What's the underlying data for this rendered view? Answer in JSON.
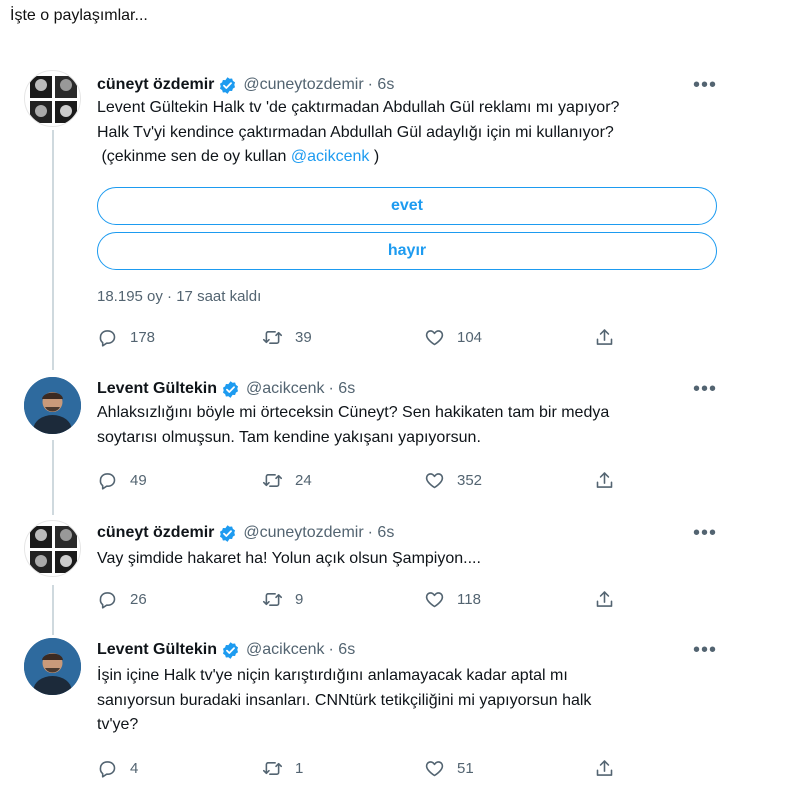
{
  "caption": "İşte o paylaşımlar...",
  "colors": {
    "accent": "#1d9bf0",
    "muted": "#536471",
    "text": "#0f1419",
    "thread_line": "#cfd9de"
  },
  "icons": {
    "reply": "reply-icon",
    "retweet": "retweet-icon",
    "like": "heart-icon",
    "share": "share-icon",
    "verified": "verified-badge-icon",
    "more": "more-icon"
  },
  "tweets": [
    {
      "name": "cüneyt özdemir",
      "handle": "@cuneytozdemir",
      "time": "· 6s",
      "more": "•••",
      "text_lines": [
        "Levent Gültekin Halk tv 'de çaktırmadan Abdullah Gül reklamı mı yapıyor?",
        "Halk Tv'yi kendince çaktırmadan Abdullah Gül adaylığı için mi kullanıyor?",
        " (çekinme sen de oy kullan "
      ],
      "mention": "@acikcenk",
      "mention_suffix": " )",
      "poll": {
        "options": [
          "evet",
          "hayır"
        ],
        "info": "18.195 oy · 17 saat kaldı"
      },
      "stats": {
        "replies": "178",
        "retweets": "39",
        "likes": "104"
      }
    },
    {
      "name": "Levent Gültekin",
      "handle": "@acikcenk",
      "time": "· 6s",
      "more": "•••",
      "text_lines": [
        "Ahlaksızlığını böyle mi örteceksin Cüneyt? Sen hakikaten tam bir medya",
        "soytarısı olmuşsun. Tam kendine yakışanı yapıyorsun."
      ],
      "stats": {
        "replies": "49",
        "retweets": "24",
        "likes": "352"
      }
    },
    {
      "name": "cüneyt özdemir",
      "handle": "@cuneytozdemir",
      "time": "· 6s",
      "more": "•••",
      "text_lines": [
        "Vay şimdide hakaret ha! Yolun açık olsun Şampiyon...."
      ],
      "stats": {
        "replies": "26",
        "retweets": "9",
        "likes": "118"
      }
    },
    {
      "name": "Levent Gültekin",
      "handle": "@acikcenk",
      "time": "· 6s",
      "more": "•••",
      "text_lines": [
        "İşin içine Halk tv'ye niçin karıştırdığını anlamayacak kadar aptal mı",
        "sanıyorsun buradaki insanları. CNNtürk tetikçiliğini mi yapıyorsun halk",
        "tv'ye?"
      ],
      "stats": {
        "replies": "4",
        "retweets": "1",
        "likes": "51"
      }
    }
  ]
}
